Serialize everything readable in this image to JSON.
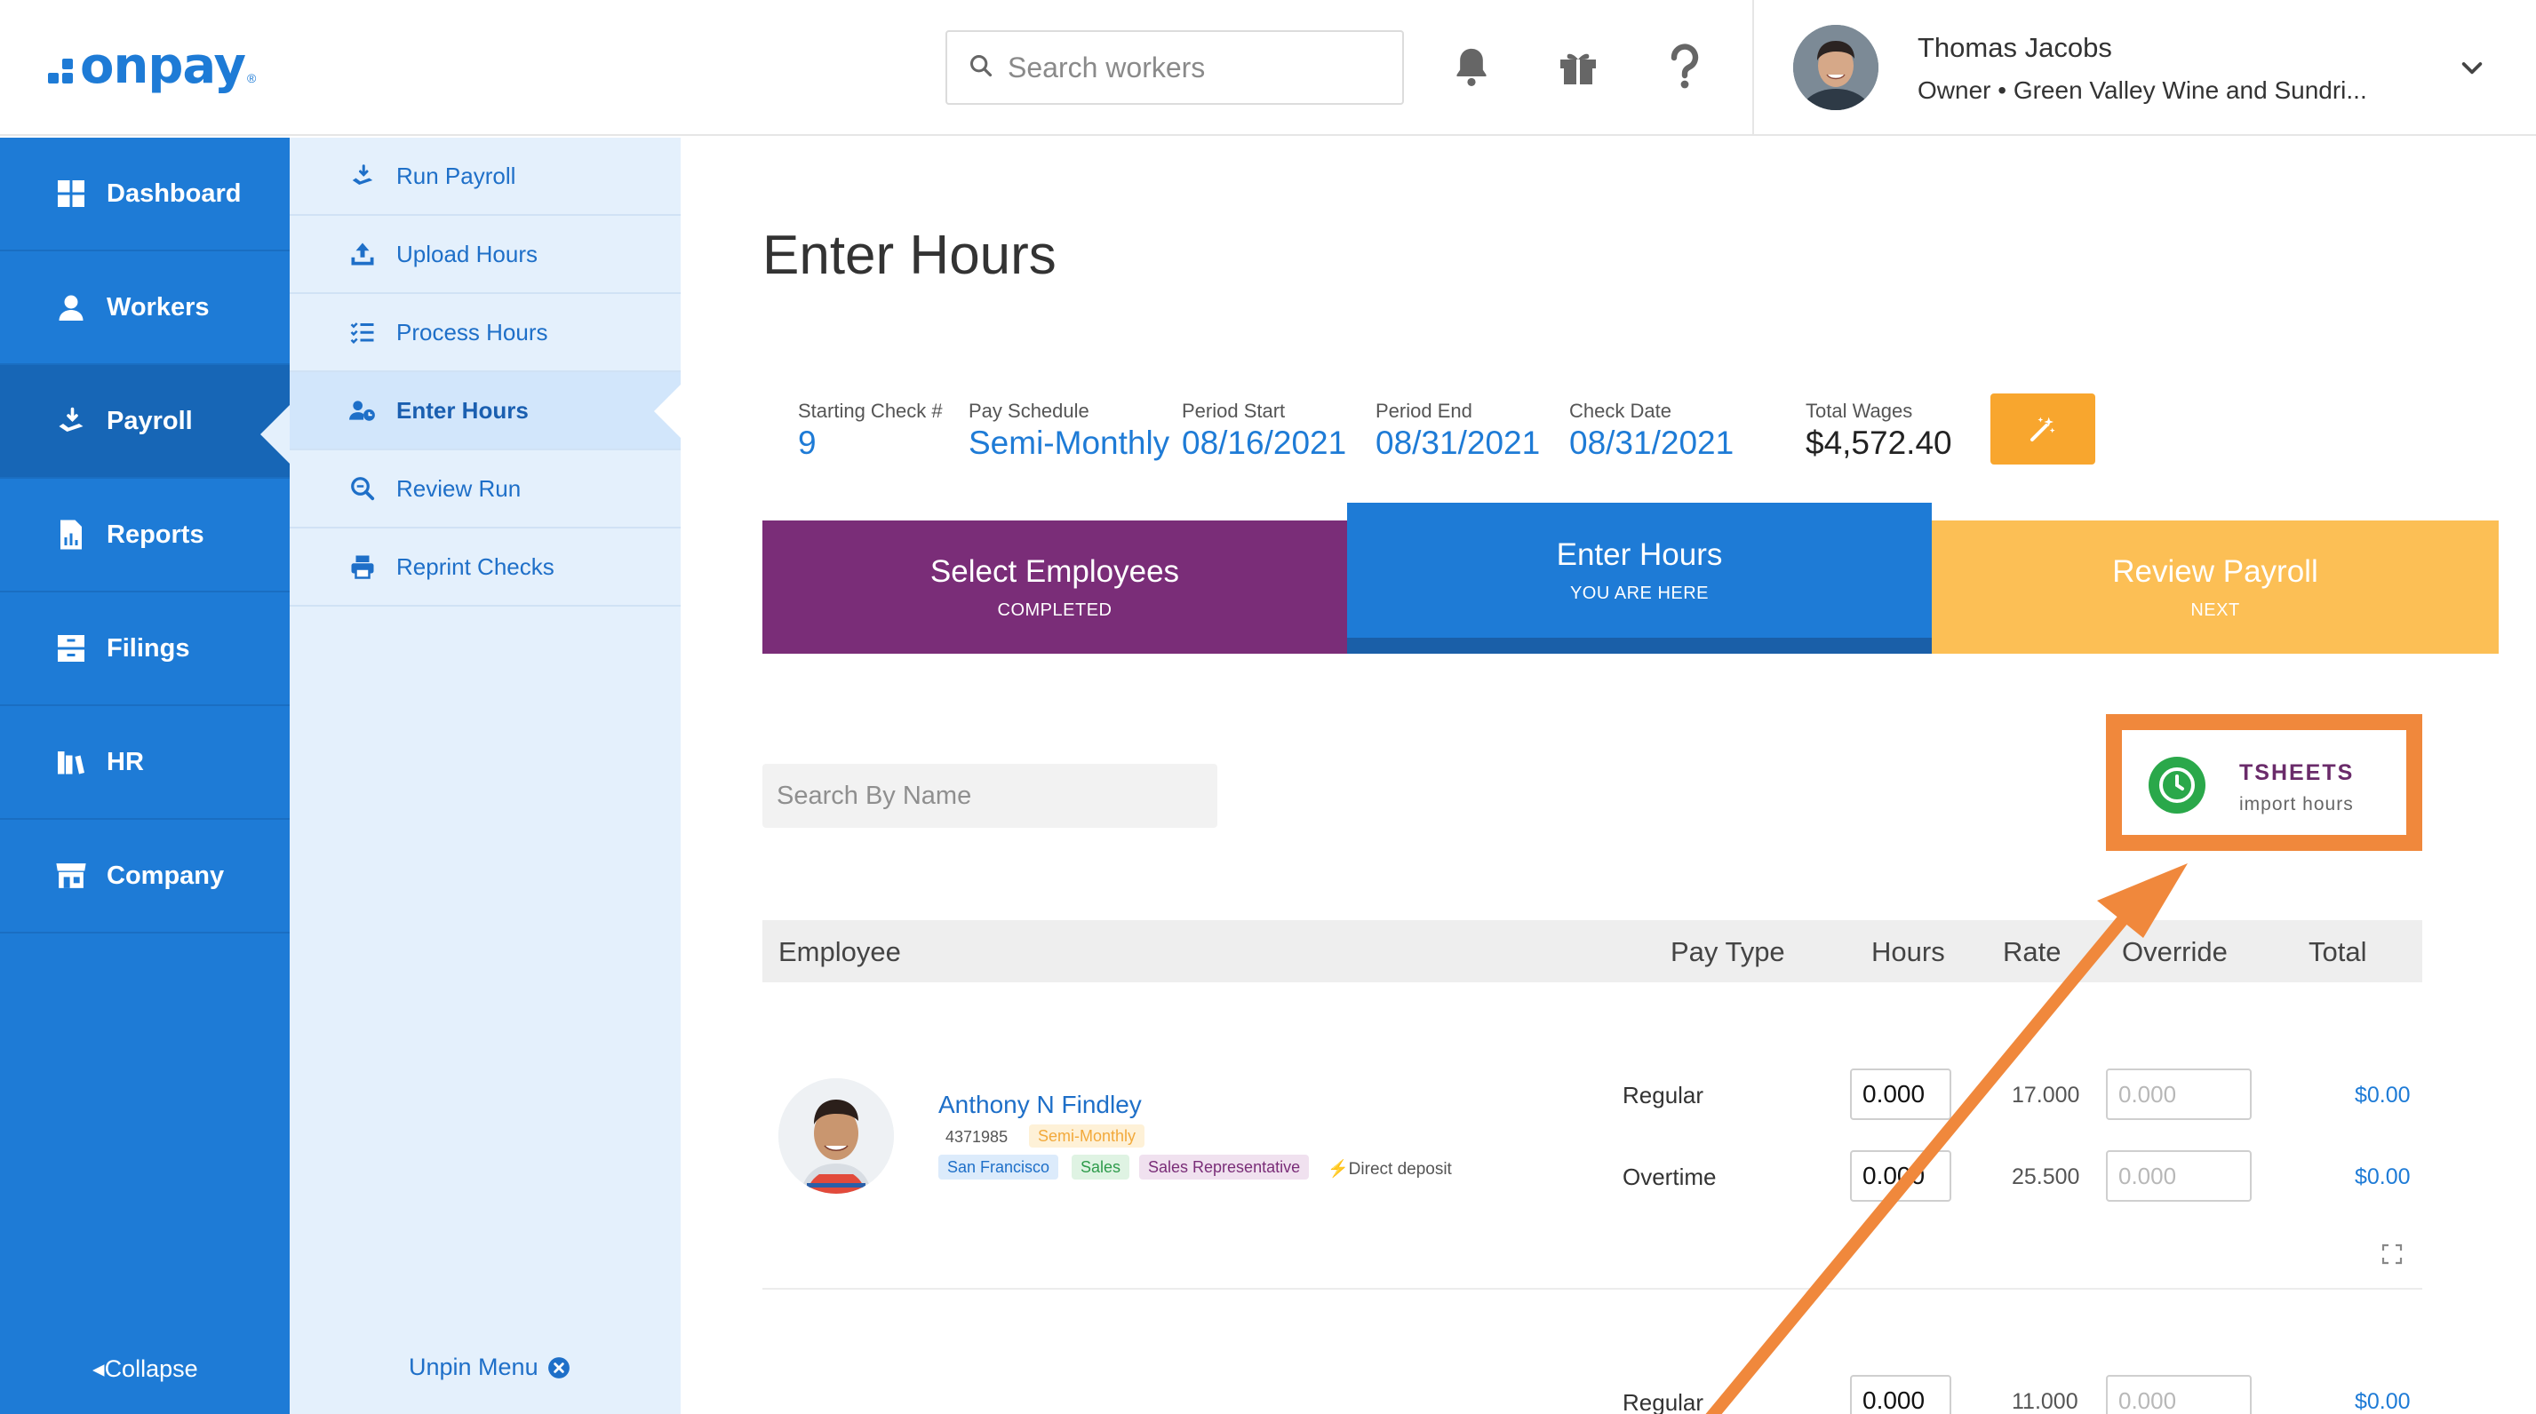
{
  "header": {
    "logo_text": "onpay",
    "logo_reg": "®",
    "search_placeholder": "Search workers",
    "user_name": "Thomas Jacobs",
    "user_role": "Owner • Green Valley Wine and Sundri..."
  },
  "sidebar": {
    "items": [
      {
        "label": "Dashboard",
        "icon": "dashboard-icon"
      },
      {
        "label": "Workers",
        "icon": "workers-icon"
      },
      {
        "label": "Payroll",
        "icon": "payroll-icon"
      },
      {
        "label": "Reports",
        "icon": "reports-icon"
      },
      {
        "label": "Filings",
        "icon": "filings-icon"
      },
      {
        "label": "HR",
        "icon": "hr-icon"
      },
      {
        "label": "Company",
        "icon": "company-icon"
      }
    ],
    "active": "Payroll",
    "collapse_label": "Collapse"
  },
  "subnav": {
    "items": [
      {
        "label": "Run Payroll",
        "icon": "run-payroll-icon"
      },
      {
        "label": "Upload Hours",
        "icon": "upload-icon"
      },
      {
        "label": "Process Hours",
        "icon": "list-icon"
      },
      {
        "label": "Enter Hours",
        "icon": "user-clock-icon"
      },
      {
        "label": "Review Run",
        "icon": "review-search-icon"
      },
      {
        "label": "Reprint Checks",
        "icon": "printer-icon"
      }
    ],
    "active": "Enter Hours",
    "unpin_label": "Unpin Menu"
  },
  "page": {
    "title": "Enter Hours"
  },
  "summary": {
    "starting_check_label": "Starting Check #",
    "starting_check_value": "9",
    "pay_schedule_label": "Pay Schedule",
    "pay_schedule_value": "Semi-Monthly",
    "period_start_label": "Period Start",
    "period_start_value": "08/16/2021",
    "period_end_label": "Period End",
    "period_end_value": "08/31/2021",
    "check_date_label": "Check Date",
    "check_date_value": "08/31/2021",
    "total_wages_label": "Total Wages",
    "total_wages_value": "$4,572.40"
  },
  "steps": [
    {
      "title": "Select Employees",
      "sub": "COMPLETED"
    },
    {
      "title": "Enter Hours",
      "sub": "YOU ARE HERE"
    },
    {
      "title": "Review Payroll",
      "sub": "NEXT"
    }
  ],
  "search_by_name_placeholder": "Search By Name",
  "tsheets": {
    "title": "TSHEETS",
    "sub": "import hours"
  },
  "table": {
    "headers": {
      "employee": "Employee",
      "pay_type": "Pay Type",
      "hours": "Hours",
      "rate": "Rate",
      "override": "Override",
      "total": "Total"
    }
  },
  "employee": {
    "name": "Anthony N Findley",
    "id": "4371985",
    "schedule_tag": "Semi-Monthly",
    "tags": [
      "San Francisco",
      "Sales",
      "Sales Representative"
    ],
    "direct_deposit": "Direct deposit",
    "rows": [
      {
        "pay_type": "Regular",
        "hours": "0.000",
        "rate": "17.000",
        "override_placeholder": "0.000",
        "total": "$0.00"
      },
      {
        "pay_type": "Overtime",
        "hours": "0.000",
        "rate": "25.500",
        "override_placeholder": "0.000",
        "total": "$0.00"
      }
    ]
  },
  "next_employee": {
    "rows": [
      {
        "pay_type": "Regular",
        "hours": "0.000",
        "rate": "11.000",
        "override_placeholder": "0.000",
        "total": "$0.00"
      }
    ]
  },
  "colors": {
    "brand_blue": "#1e7bd6",
    "step_completed": "#7a2d78",
    "step_next": "#fcbf55",
    "annotation_orange": "#f0883c",
    "magic_button": "#f8a62e"
  }
}
